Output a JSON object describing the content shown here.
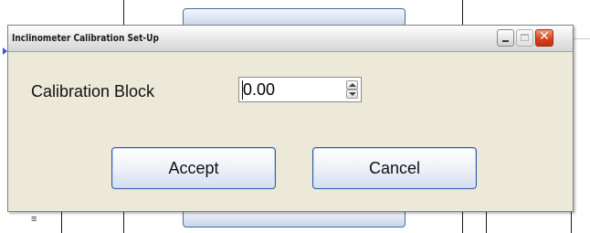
{
  "window": {
    "title": "Inclinometer Calibration Set-Up"
  },
  "titlebar_buttons": {
    "minimize": "minimize-icon",
    "maximize": "maximize-icon",
    "close": "close-icon"
  },
  "calibration": {
    "label": "Calibration Block",
    "value": "0.00"
  },
  "buttons": {
    "accept": "Accept",
    "cancel": "Cancel"
  },
  "colors": {
    "dialog_bg": "#ece9d8",
    "button_border": "#2f5aa8",
    "close_button": "#d8431c"
  }
}
